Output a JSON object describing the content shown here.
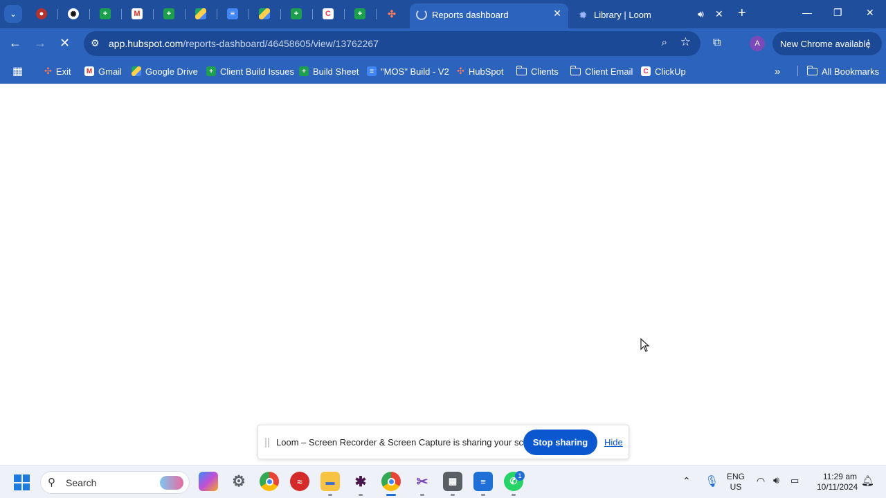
{
  "browser": {
    "tabs": [
      {
        "label": "Reports dashboard",
        "active": true
      },
      {
        "label": "Library | Loom",
        "active": false,
        "audio": true
      }
    ],
    "url_host": "app.hubspot.com",
    "url_path": "/reports-dashboard/46458605/view/13762267",
    "update_label": "New Chrome available",
    "profile_initial": "A"
  },
  "bookmarks": {
    "items": [
      {
        "label": "Exit",
        "icon": "hubspot-icon"
      },
      {
        "label": "Gmail",
        "icon": "gmail-icon"
      },
      {
        "label": "Google Drive",
        "icon": "drive-icon"
      },
      {
        "label": "Client Build Issues",
        "icon": "sheets-icon"
      },
      {
        "label": "Build Sheet",
        "icon": "sheets-icon"
      },
      {
        "label": "\"MOS\" Build - V2",
        "icon": "docs-icon"
      },
      {
        "label": "HubSpot",
        "icon": "hubspot-icon"
      },
      {
        "label": "Clients",
        "icon": "folder-icon"
      },
      {
        "label": "Client Email",
        "icon": "folder-icon"
      },
      {
        "label": "ClickUp",
        "icon": "clickup-icon"
      }
    ],
    "all_label": "All Bookmarks"
  },
  "loom_bar": {
    "message": "Loom – Screen Recorder & Screen Capture is sharing your screen.",
    "stop_label": "Stop sharing",
    "hide_label": "Hide"
  },
  "taskbar": {
    "search_label": "Search",
    "lang_top": "ENG",
    "lang_bottom": "US",
    "time": "11:29 am",
    "date": "10/11/2024",
    "whatsapp_badge": "1"
  },
  "colors": {
    "chrome_frame": "#1f4f9c",
    "chrome_toolbar": "#2c64bd",
    "stop_button": "#0b57d0"
  }
}
